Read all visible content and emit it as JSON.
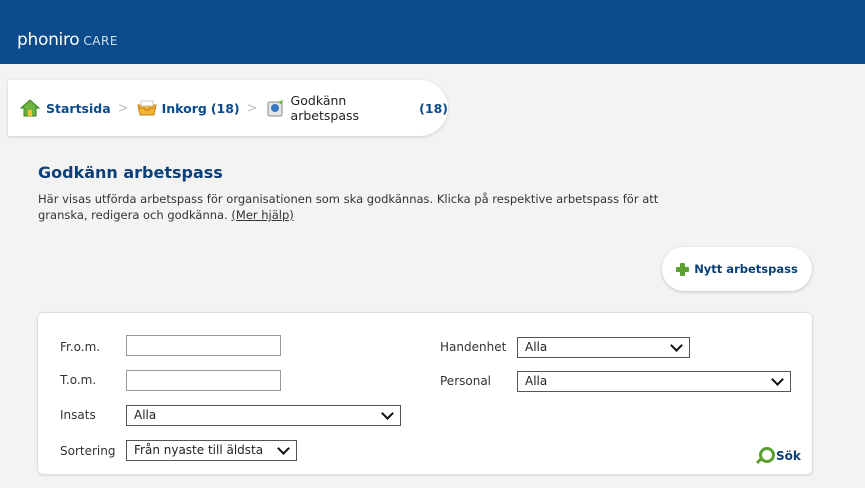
{
  "header": {
    "logo_main": "phoniro",
    "logo_sub": "CARE"
  },
  "breadcrumb": {
    "home": "Startsida",
    "inbox": "Inkorg",
    "inbox_count": "(18)",
    "current": "Godkänn arbetspass",
    "current_count": "(18)"
  },
  "page": {
    "title": "Godkänn arbetspass",
    "description": "Här visas utförda arbetspass för organisationen som ska godkännas. Klicka på respektive arbetspass för att granska, redigera och godkänna.",
    "help_link": "(Mer hjälp)",
    "new_button": "Nytt arbetspass"
  },
  "filters": {
    "from_label": "Fr.o.m.",
    "from_value": "",
    "to_label": "T.o.m.",
    "to_value": "",
    "insats_label": "Insats",
    "insats_value": "Alla",
    "sort_label": "Sortering",
    "sort_value": "Från nyaste till äldsta",
    "handenhet_label": "Handenhet",
    "handenhet_value": "Alla",
    "personal_label": "Personal",
    "personal_value": "Alla",
    "search_button": "Sök"
  },
  "icons": [
    "home-icon",
    "inbox-icon",
    "approve-shift-icon",
    "plus-icon",
    "search-icon",
    "chevron-down-icon"
  ],
  "colors": {
    "brand": "#0b4a8b",
    "title": "#0b3f78",
    "accent_green": "#5ca031"
  }
}
